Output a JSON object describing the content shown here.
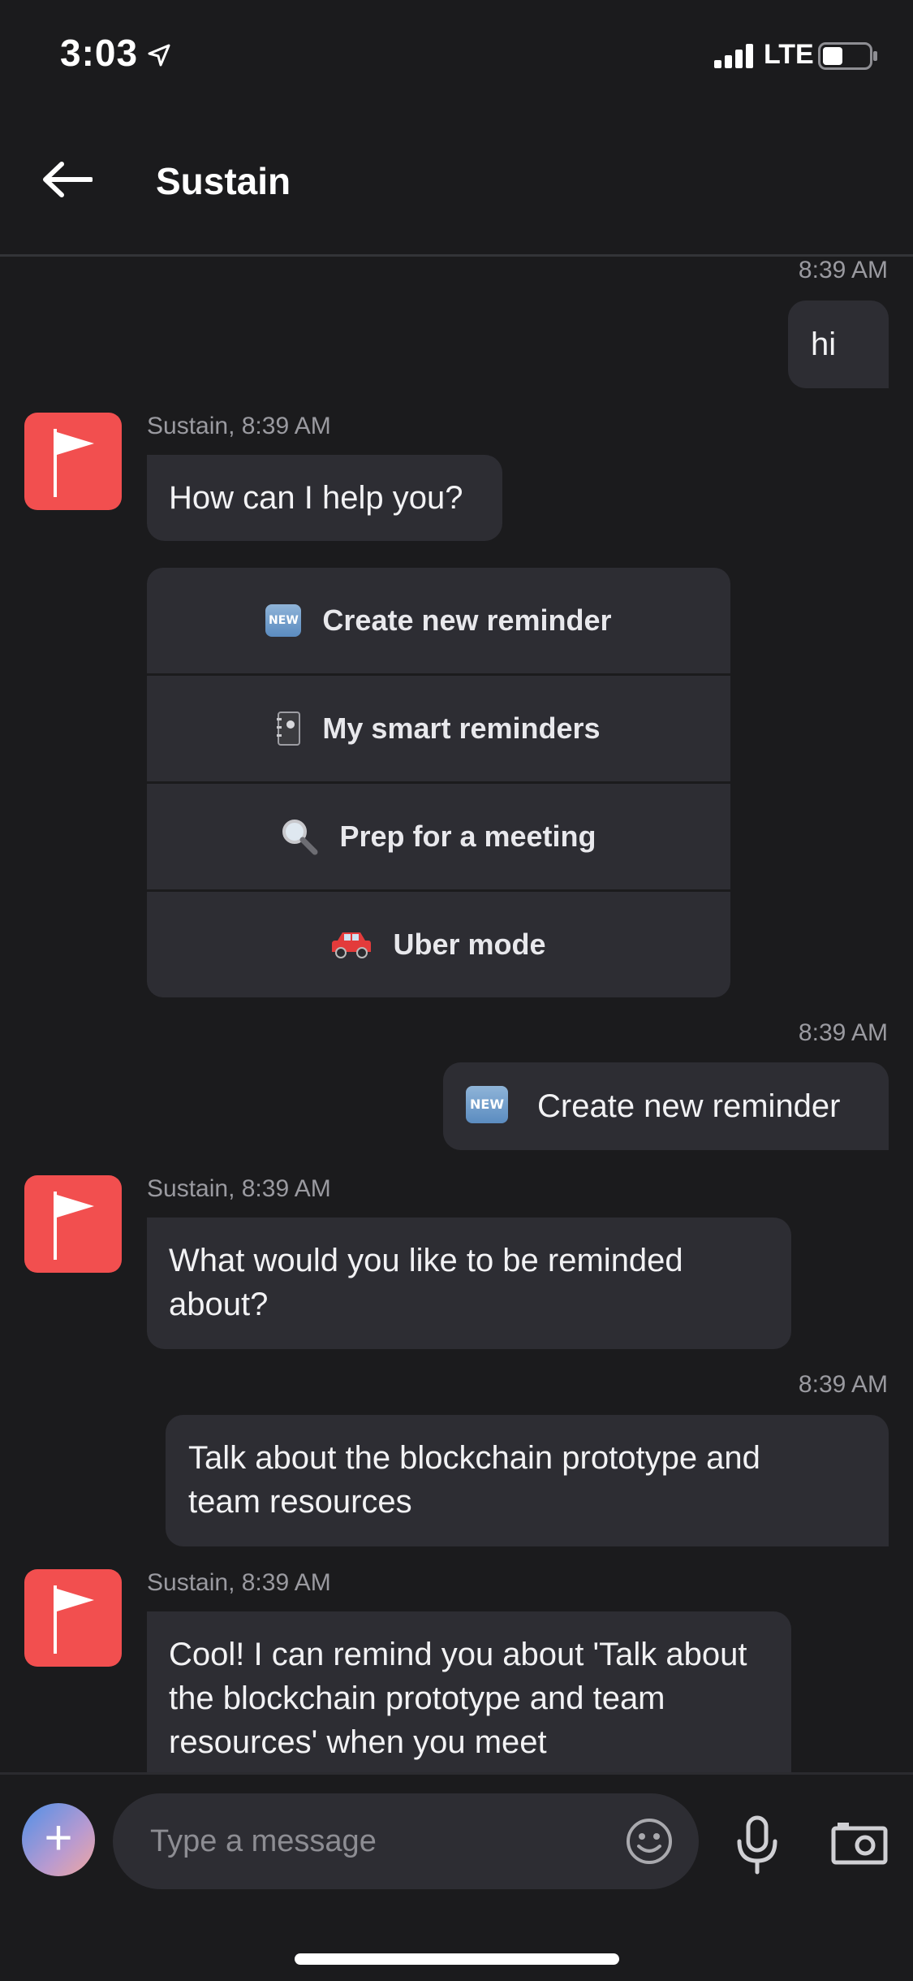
{
  "status_bar": {
    "time": "3:03",
    "network": "LTE"
  },
  "header": {
    "title": "Sustain"
  },
  "messages": [
    {
      "side": "out",
      "time": "8:39 AM",
      "text": "hi"
    },
    {
      "side": "in",
      "meta": "Sustain, 8:39 AM",
      "text": "How can I help you?"
    },
    {
      "side": "options",
      "items": [
        {
          "icon": "new-badge-icon",
          "label": "Create new reminder"
        },
        {
          "icon": "notebook-icon",
          "label": "My smart reminders"
        },
        {
          "icon": "magnifier-icon",
          "label": "Prep for a meeting"
        },
        {
          "icon": "car-icon",
          "label": "Uber mode"
        }
      ]
    },
    {
      "side": "out",
      "time": "8:39 AM",
      "text": "Create new reminder",
      "icon": "new-badge-icon"
    },
    {
      "side": "in",
      "meta": "Sustain, 8:39 AM",
      "text": "What would you like to be reminded about?"
    },
    {
      "side": "out",
      "time": "8:39 AM",
      "text": "Talk about the blockchain prototype and team resources"
    },
    {
      "side": "in",
      "meta": "Sustain, 8:39 AM",
      "text": "Cool! I can remind you about 'Talk about the blockchain prototype and team resources' when you meet"
    }
  ],
  "badge_text": "NEW",
  "composer": {
    "placeholder": "Type a message"
  },
  "colors": {
    "background": "#1b1b1d",
    "bubble": "#2d2d33",
    "avatar": "#f24f4f",
    "meta_text": "#9a9aa0"
  }
}
